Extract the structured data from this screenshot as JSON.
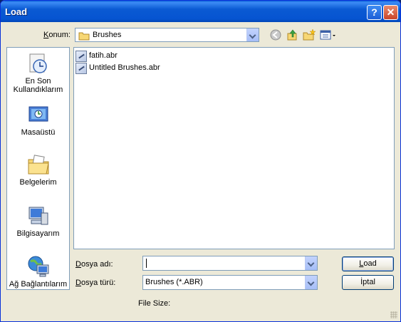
{
  "window": {
    "title": "Load"
  },
  "titlebar": {
    "help_label": "?",
    "close_label": "✕"
  },
  "location": {
    "label_prefix": "",
    "label_key": "K",
    "label_rest": "onum:",
    "value": "Brushes"
  },
  "toolbar": {
    "icons": [
      "back-icon",
      "up-folder-icon",
      "new-folder-icon",
      "view-menu-icon"
    ]
  },
  "places": [
    {
      "label": "En Son Kullandıklarım",
      "icon": "recent-documents-icon"
    },
    {
      "label": "Masaüstü",
      "icon": "desktop-icon"
    },
    {
      "label": "Belgelerim",
      "icon": "my-documents-icon"
    },
    {
      "label": "Bilgisayarım",
      "icon": "my-computer-icon"
    },
    {
      "label": "Ağ Bağlantılarım",
      "icon": "network-places-icon"
    }
  ],
  "files": [
    {
      "name": "fatih.abr"
    },
    {
      "name": "Untitled Brushes.abr"
    }
  ],
  "filename": {
    "label_key": "D",
    "label_rest": "osya adı:",
    "value": ""
  },
  "filetype": {
    "label_key": "D",
    "label_rest": "osya türü:",
    "value": "Brushes (*.ABR)"
  },
  "buttons": {
    "load_key": "L",
    "load_rest": "oad",
    "cancel": "İptal"
  },
  "status": {
    "file_size_label": "File Size:"
  },
  "colors": {
    "title_blue": "#0a5ad3",
    "dialog_bg": "#ece9d8",
    "border": "#7f9db9"
  }
}
